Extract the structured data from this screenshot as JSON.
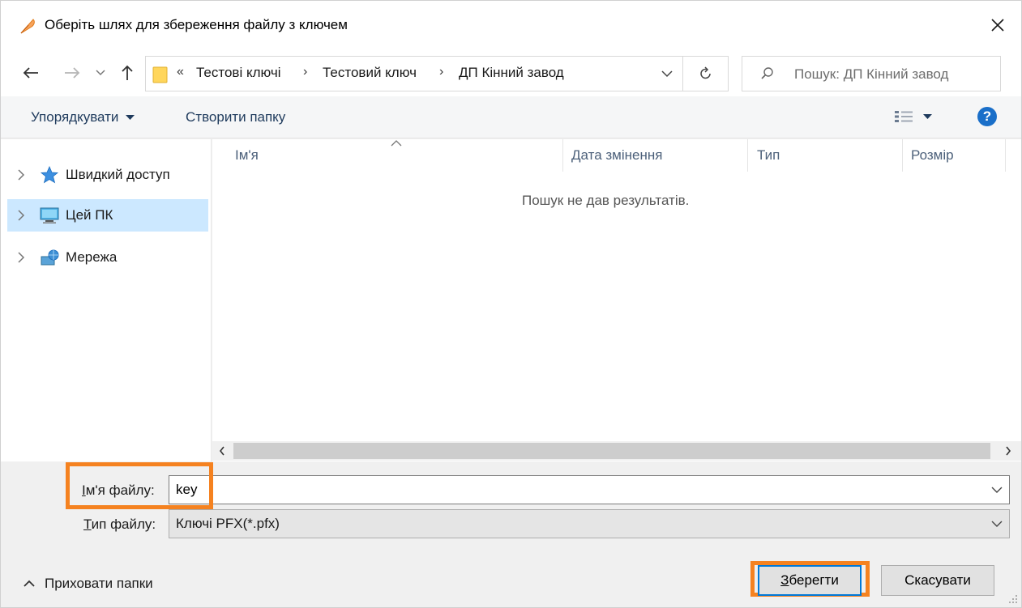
{
  "window": {
    "title": "Оберіть шлях для збереження файлу з ключем",
    "close_glyph": "✕"
  },
  "nav": {
    "back_glyph": "←",
    "forward_glyph": "→",
    "recent_glyph": "⌄",
    "up_glyph": "↑",
    "breadcrumb_prefix": "«",
    "breadcrumbs": [
      "Тестові ключі",
      "Тестовий ключ",
      "ДП Кінний завод"
    ],
    "crumb_sep": "›",
    "refresh_glyph": "↻",
    "search_placeholder": "Пошук: ДП Кінний завод"
  },
  "toolbar": {
    "organize_label": "Упорядкувати",
    "new_folder_label": "Створити папку",
    "help_glyph": "?"
  },
  "sidebar": {
    "items": [
      {
        "label": "Швидкий доступ",
        "icon": "star-icon",
        "selected": false
      },
      {
        "label": "Цей ПК",
        "icon": "computer-icon",
        "selected": true
      },
      {
        "label": "Мережа",
        "icon": "network-icon",
        "selected": false
      }
    ]
  },
  "list": {
    "columns": [
      "Ім'я",
      "Дата змінення",
      "Тип",
      "Розмір"
    ],
    "empty_message": "Пошук не дав результатів."
  },
  "form": {
    "filename_label_u": "І",
    "filename_label_rest": "м'я файлу:",
    "filename_value": "key",
    "filetype_label_u": "Т",
    "filetype_label_rest": "ип файлу:",
    "filetype_value": "Ключі PFX(*.pfx)"
  },
  "footer": {
    "hide_folders_label": "Приховати папки",
    "save_label_u": "З",
    "save_label_rest": "берегти",
    "cancel_label": "Скасувати"
  },
  "colors": {
    "highlight": "#f58220",
    "selection": "#cce8ff",
    "help": "#1a6fc9"
  }
}
